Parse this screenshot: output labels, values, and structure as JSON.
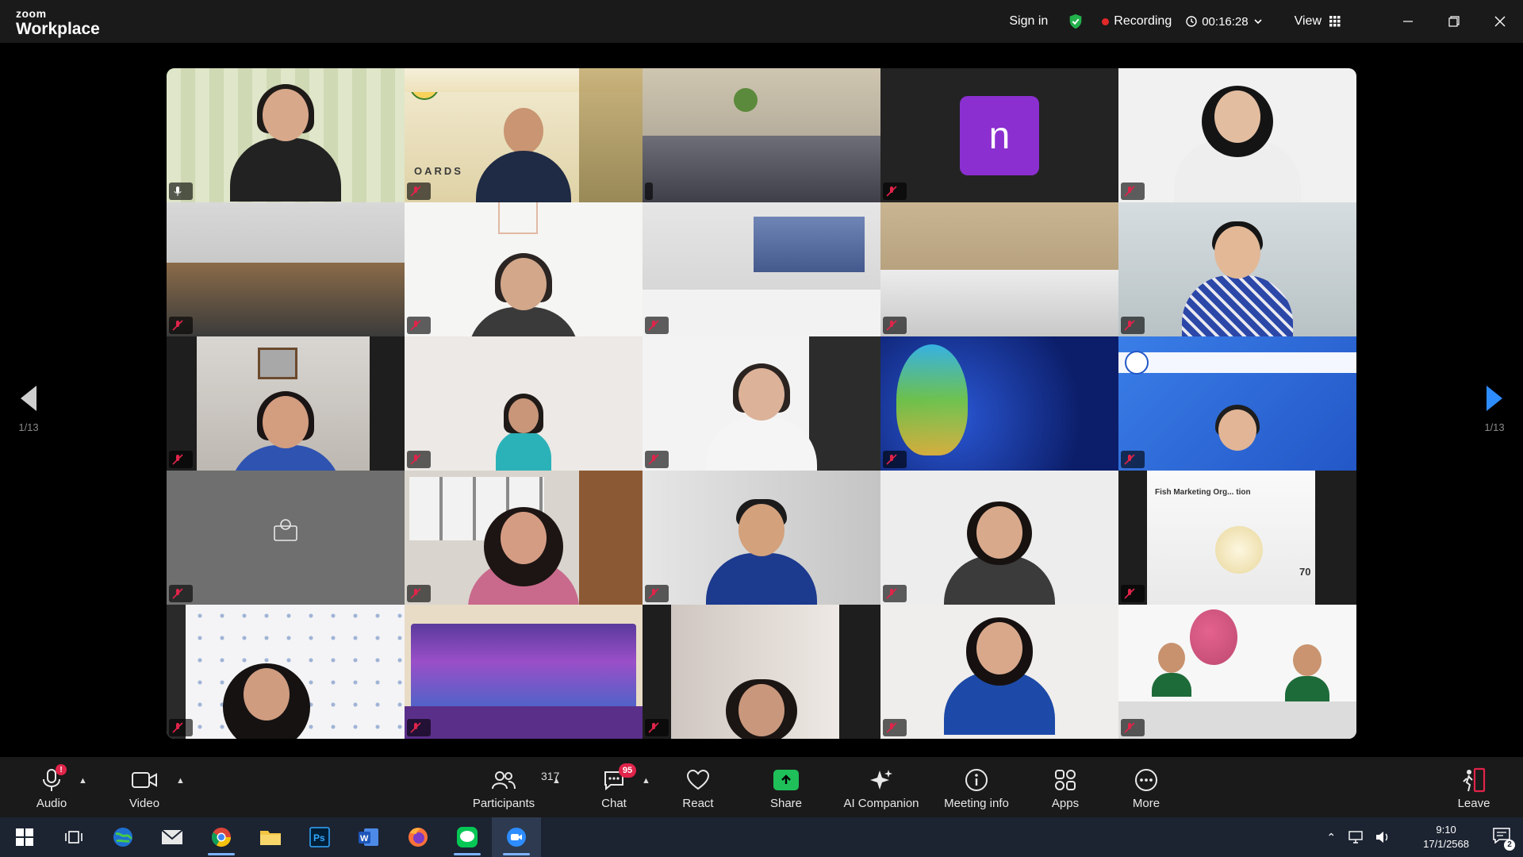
{
  "app": {
    "brand_top": "zoom",
    "brand_bottom": "Workplace"
  },
  "titlebar": {
    "sign_in": "Sign in",
    "recording": "Recording",
    "timer": "00:16:28",
    "view": "View"
  },
  "pager": {
    "left": "1/13",
    "right": "1/13"
  },
  "tiles": {
    "t2_banner": "",
    "t2_deco": "OARDS",
    "t4_avatar_letter": "n",
    "t14_deco": "",
    "t14_deco2": "",
    "t20_deco": "Fish Marketing Org... tion",
    "t20_num": "70",
    "t22_deco": ""
  },
  "names": [
    "",
    "",
    "",
    "",
    "",
    "",
    "",
    "",
    "",
    "",
    "",
    "",
    "",
    "",
    "",
    "",
    "",
    "",
    "",
    "",
    "",
    "",
    "",
    "",
    ""
  ],
  "toolbar": {
    "audio": "Audio",
    "audio_badge": "!",
    "video": "Video",
    "participants": "Participants",
    "participants_count": "317",
    "chat": "Chat",
    "chat_badge": "95",
    "react": "React",
    "share": "Share",
    "ai": "AI Companion",
    "info": "Meeting info",
    "apps": "Apps",
    "more": "More",
    "leave": "Leave"
  },
  "taskbar": {
    "time": "9:10",
    "date": "17/1/2568",
    "lang": "",
    "notif_count": "2"
  }
}
